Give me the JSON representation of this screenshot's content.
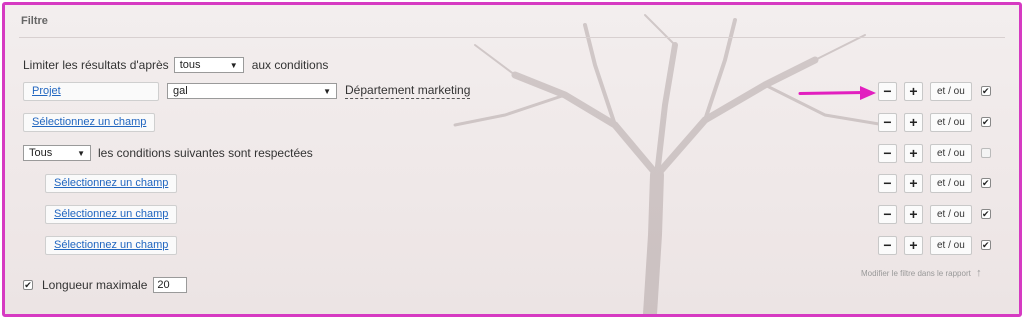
{
  "panel": {
    "title": "Filtre"
  },
  "limit": {
    "prefix": "Limiter les résultats d'après",
    "select_value": "tous",
    "suffix": "aux conditions"
  },
  "conditions": [
    {
      "field": "Projet",
      "operator": "gal",
      "value": "Département marketing",
      "checked": true
    },
    {
      "field": "Sélectionnez un champ",
      "checked": true
    },
    {
      "group_select": "Tous",
      "group_text": "les conditions suivantes sont respectées",
      "checked": false
    },
    {
      "field": "Sélectionnez un champ",
      "checked": true
    },
    {
      "field": "Sélectionnez un champ",
      "checked": true
    },
    {
      "field": "Sélectionnez un champ",
      "checked": true
    }
  ],
  "controls": {
    "minus_label": "−",
    "plus_label": "+",
    "etou_label": "et / ou"
  },
  "modify_link": {
    "label": "Modifier le filtre dans le rapport",
    "icon": "arrow-up-icon"
  },
  "max_length": {
    "label": "Longueur maximale",
    "value": "20",
    "checked": true
  },
  "colors": {
    "frame": "#d63ac2",
    "link": "#2166c0",
    "annotation_arrow": "#e21fbf"
  }
}
